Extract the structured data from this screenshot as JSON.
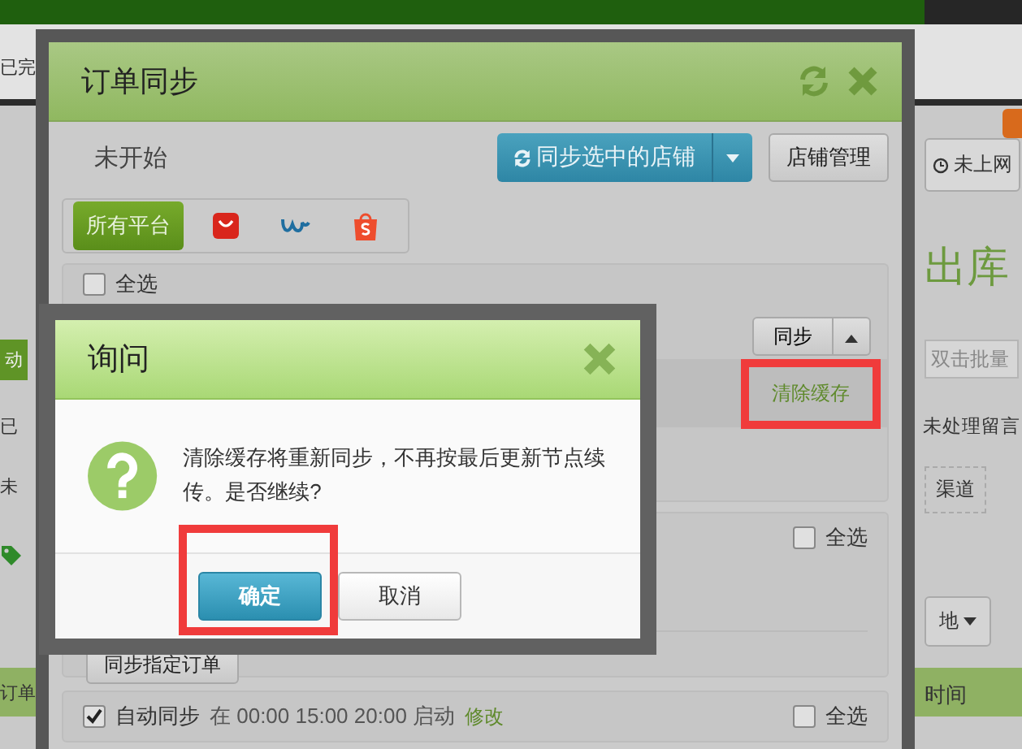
{
  "page": {
    "left_fragments": [
      {
        "kind": "text",
        "text": "已完"
      },
      {
        "kind": "button",
        "text": "动"
      },
      {
        "kind": "text",
        "text": "已"
      },
      {
        "kind": "text",
        "text": "未"
      },
      {
        "kind": "tag"
      },
      {
        "kind": "header",
        "text": "订单"
      }
    ],
    "right_fragments": [
      {
        "kind": "badge"
      },
      {
        "kind": "status_button",
        "text": "未上网"
      },
      {
        "kind": "heading",
        "text": "出库"
      },
      {
        "kind": "field",
        "placeholder": "双击批量"
      },
      {
        "kind": "text",
        "text": "未处理留言"
      },
      {
        "kind": "chip",
        "text": "渠道"
      },
      {
        "kind": "dropdown",
        "text": "地"
      },
      {
        "kind": "header",
        "text": "时间"
      }
    ]
  },
  "sync_dialog": {
    "title": "订单同步",
    "status": "未开始",
    "sync_button": "同步选中的店铺",
    "manage_button": "店铺管理",
    "platforms": [
      {
        "kind": "all",
        "label": "所有平台",
        "selected": true
      },
      {
        "kind": "red_bag",
        "selected": false
      },
      {
        "kind": "w_logo",
        "selected": false
      },
      {
        "kind": "orange_bag",
        "selected": false
      }
    ],
    "shops_panel": {
      "select_all": {
        "label": "全选",
        "checked": false
      },
      "sync_button": "同步",
      "clear_cache_link": "清除缓存"
    },
    "orders_panel": {
      "select_all": {
        "label": "全选",
        "checked": false
      },
      "sync_orders_button": "同步指定订单"
    },
    "auto_panel": {
      "auto_sync": {
        "label": "自动同步",
        "checked": true
      },
      "schedule": "在 00:00 15:00 20:00 启动",
      "edit_link": "修改",
      "select_all": {
        "label": "全选",
        "checked": false
      }
    }
  },
  "confirm_dialog": {
    "title": "询问",
    "message": "清除缓存将重新同步，不再按最后更新节点续传。是否继续?",
    "buttons": [
      {
        "kind": "primary",
        "label": "确定"
      },
      {
        "kind": "default",
        "label": "取消"
      }
    ]
  }
}
